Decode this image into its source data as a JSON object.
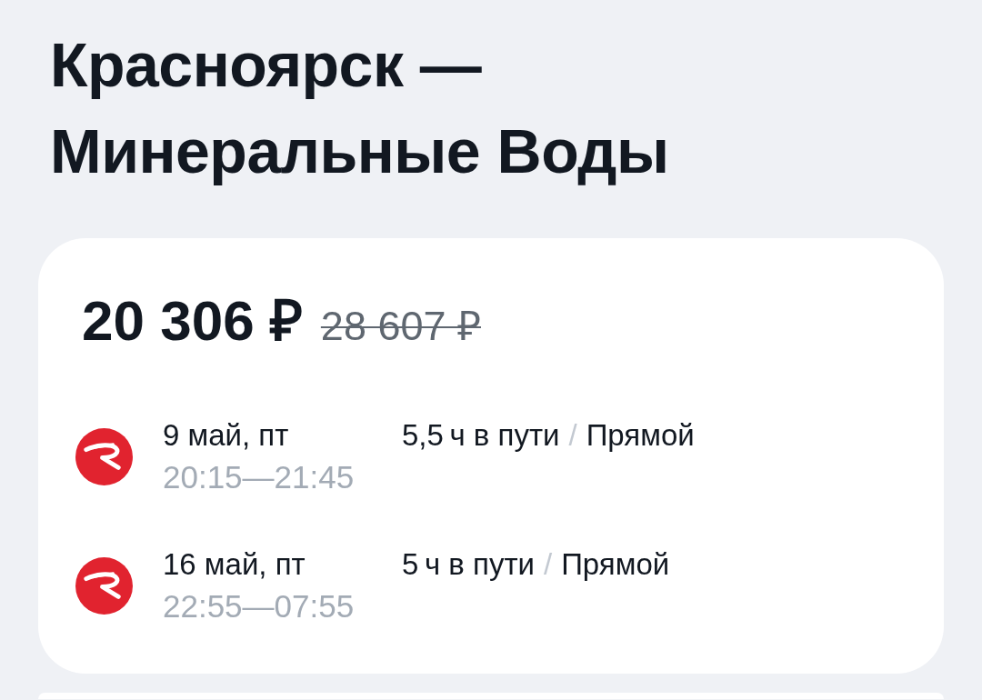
{
  "route_title": "Красноярск — Минеральные Воды",
  "offer": {
    "price": "20 306 ₽",
    "old_price": "28 607 ₽",
    "segments": [
      {
        "date": "9 май, пт",
        "times": "20:15—21:45",
        "duration": "5,5 ч в пути",
        "separator": "/",
        "stops": "Прямой"
      },
      {
        "date": "16 май, пт",
        "times": "22:55—07:55",
        "duration": "5 ч в пути",
        "separator": "/",
        "stops": "Прямой"
      }
    ]
  }
}
